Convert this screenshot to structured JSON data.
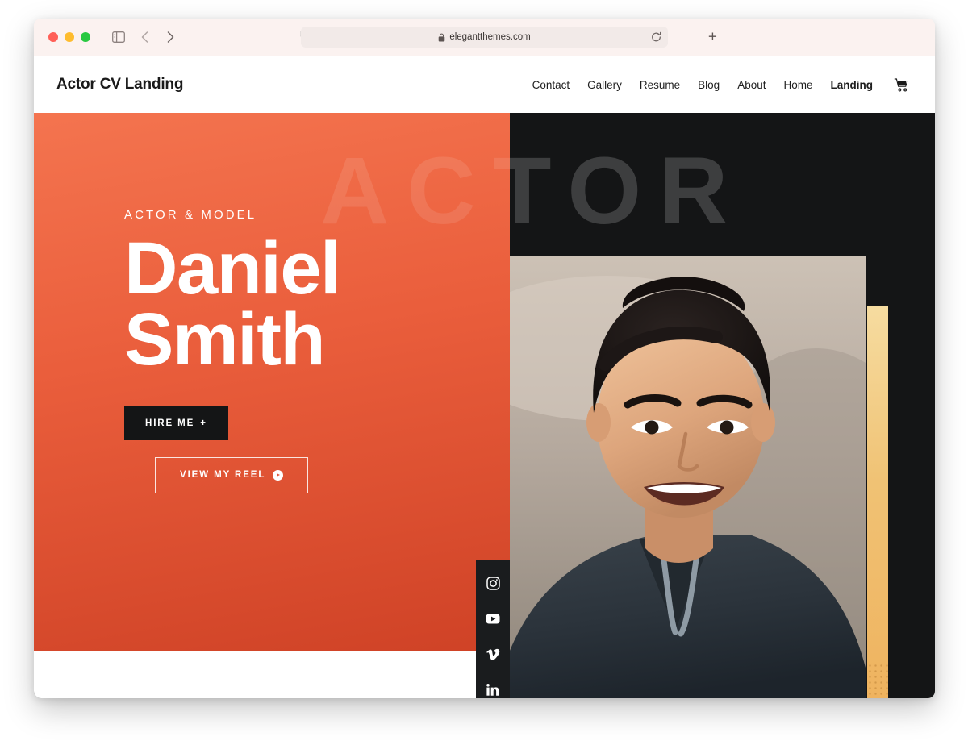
{
  "browser": {
    "url": "elegantthemes.com",
    "lock_icon": "lock-icon",
    "reload_icon": "reload-icon",
    "new_tab_icon": "plus-icon",
    "shield_icon": "privacy-shield-icon",
    "sidebar_icon": "sidebar-toggle-icon",
    "back_icon": "chevron-left-icon",
    "forward_icon": "chevron-right-icon",
    "traffic_lights": [
      "close-red",
      "minimize-yellow",
      "maximize-green"
    ]
  },
  "site": {
    "title": "Actor CV Landing",
    "nav": [
      {
        "label": "Contact",
        "active": false
      },
      {
        "label": "Gallery",
        "active": false
      },
      {
        "label": "Resume",
        "active": false
      },
      {
        "label": "Blog",
        "active": false
      },
      {
        "label": "About",
        "active": false
      },
      {
        "label": "Home",
        "active": false
      },
      {
        "label": "Landing",
        "active": true
      }
    ],
    "cart_icon": "shopping-cart-icon"
  },
  "hero": {
    "watermark": "ACTOR",
    "eyebrow": "ACTOR & MODEL",
    "name_line1": "Daniel",
    "name_line2": "Smith",
    "primary_cta": "HIRE ME",
    "primary_cta_suffix": "+",
    "secondary_cta": "VIEW MY REEL",
    "secondary_cta_icon": "play-circle-icon"
  },
  "social": [
    {
      "name": "instagram",
      "label": "Instagram"
    },
    {
      "name": "youtube",
      "label": "YouTube"
    },
    {
      "name": "vimeo",
      "label": "Vimeo"
    },
    {
      "name": "linkedin",
      "label": "LinkedIn"
    }
  ],
  "colors": {
    "orange_top": "#f4744f",
    "orange_bottom": "#cf4226",
    "dark": "#141516",
    "gold": "#efb35f",
    "white": "#ffffff"
  }
}
